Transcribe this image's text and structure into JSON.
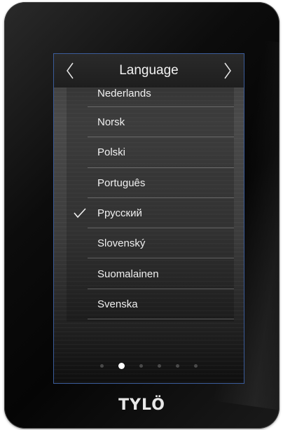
{
  "header": {
    "title": "Language",
    "prev_icon": "chevron-left-icon",
    "next_icon": "chevron-right-icon"
  },
  "languages": [
    {
      "label": "Nederlands",
      "selected": false
    },
    {
      "label": "Norsk",
      "selected": false
    },
    {
      "label": "Polski",
      "selected": false
    },
    {
      "label": "Português",
      "selected": false
    },
    {
      "label": "Pрусский",
      "selected": true
    },
    {
      "label": "Slovenský",
      "selected": false
    },
    {
      "label": "Suomalainen",
      "selected": false
    },
    {
      "label": "Svenska",
      "selected": false
    }
  ],
  "pagination": {
    "total": 6,
    "active": 2
  },
  "brand": {
    "logo_text": "TYLÖ"
  },
  "colors": {
    "accent_border": "#3b5c9a",
    "text": "#f0f0f0",
    "device": "#0a0a0a"
  }
}
